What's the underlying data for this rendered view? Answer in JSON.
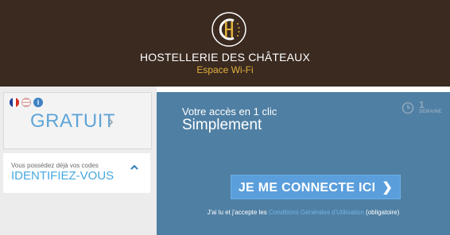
{
  "header": {
    "brand_name": "HOSTELLERIE DES CHÂTEAUX",
    "subtitle": "Espace Wi-Fi",
    "background_color": "#3a2a20",
    "accent_color": "#e1b13c"
  },
  "language_icons": [
    "flag-fr-icon",
    "flag-en-icon",
    "info-icon"
  ],
  "free_option": {
    "label": "GRATUIT",
    "arrow_icon": "chevron-right-icon"
  },
  "codes_option": {
    "prompt": "Vous possédez déjà vos codes",
    "label": "IDENTIFIEZ-VOUS",
    "icon": "chevron-up-icon"
  },
  "access_panel": {
    "line1": "Votre accès en 1 clic",
    "line2": "Simplement",
    "duration_value": "1",
    "duration_unit": "SEMAINE",
    "button_label": "JE ME CONNECTE ICI",
    "terms_prefix": "J'ai lu et j'accepte les ",
    "terms_link": "Conditions Générales d'Utilisation",
    "terms_suffix": " (obligatoire)",
    "panel_color": "#4f7fa3",
    "button_color": "#5a9edb"
  }
}
